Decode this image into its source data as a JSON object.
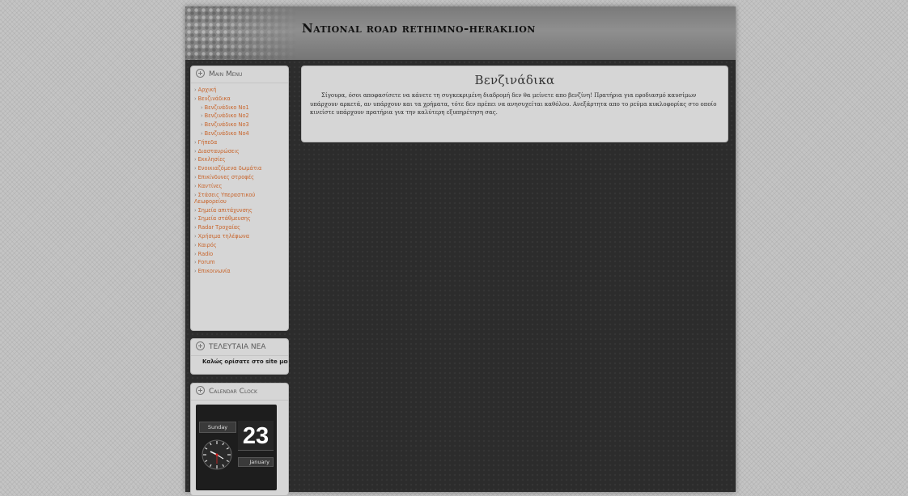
{
  "site": {
    "title": "National road rethimno-heraklion"
  },
  "main_menu": {
    "heading": "Main Menu",
    "items": [
      {
        "label": "Αρχική",
        "level": 0
      },
      {
        "label": "Βενζινάδικα",
        "level": 0
      },
      {
        "label": "Βενζινάδικο No1",
        "level": 1
      },
      {
        "label": "Βενζινάδικο No2",
        "level": 1
      },
      {
        "label": "Βενζινάδικο No3",
        "level": 1
      },
      {
        "label": "Βενζινάδικο No4",
        "level": 1
      },
      {
        "label": "Γήπεδα",
        "level": 0
      },
      {
        "label": "Διασταυρώσεις",
        "level": 0
      },
      {
        "label": "Εκκλησίες",
        "level": 0
      },
      {
        "label": "Ενοικιαζόμενα δωμάτια",
        "level": 0
      },
      {
        "label": "Επικίνδυνες στροφές",
        "level": 0
      },
      {
        "label": "Καντίνες",
        "level": 0
      },
      {
        "label": "Στάσεις Υπεραστικού Λεωφορείου",
        "level": 0
      },
      {
        "label": "Σημεία απιτάχυνσης",
        "level": 0
      },
      {
        "label": "Σημεία στάθμευσης",
        "level": 0
      },
      {
        "label": "Radar Τροχαίας",
        "level": 0
      },
      {
        "label": "Χρήσιμα τηλέφωνα",
        "level": 0
      },
      {
        "label": "Καιρός",
        "level": 0
      },
      {
        "label": "Radio",
        "level": 0
      },
      {
        "label": "Forum",
        "level": 0
      },
      {
        "label": "Επικοινωνία",
        "level": 0
      }
    ]
  },
  "latest_news": {
    "heading": "ΤΕΛΕΥΤΑΙΑ ΝΕΑ",
    "text": "Καλώς ορίσατε στο site μας"
  },
  "calendar_clock": {
    "heading": "Calendar Clock",
    "day": "Sunday",
    "date": "23",
    "month": "January"
  },
  "content": {
    "title": "Βενζινάδικα",
    "body": "Σίγουρα, όσοι αποφασίσετε να κάνετε τη συγκεκριμένη διαδρομή δεν θα μείνετε απο βενζίνη! Πρατήρια για εφοδιασμό καυσίμων υπάρχουν αρκετά, αν υπάρχουν και τα χρήματα, τότε δεν πρέπει να ανησυχείται καθόλου. Ανεξάρτητα απο το ρεύμα κυκλοφορίας στο οποίο κινείστε υπάρχουν πρατήρια για την καλύτερη εξυπηρέτηση σας."
  },
  "colors": {
    "menu_link": "#c8642a",
    "page_bg": "#2c2c2c",
    "box_bg": "#d6d6d6"
  }
}
